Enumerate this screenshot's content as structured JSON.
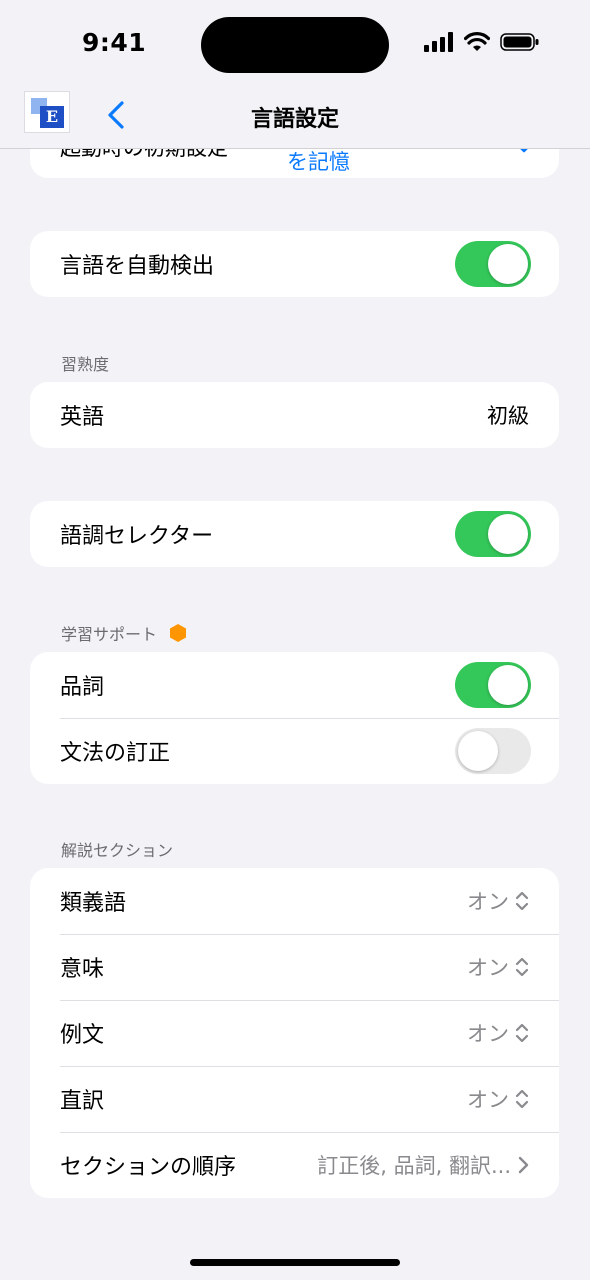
{
  "status": {
    "time": "9:41"
  },
  "nav": {
    "title": "言語設定",
    "logo_letter": "E"
  },
  "startup": {
    "label": "起動時の初期設定",
    "value": "を記憶"
  },
  "auto_detect": {
    "label": "言語を自動検出",
    "on": true
  },
  "proficiency": {
    "header": "習熟度",
    "row_label": "英語",
    "row_value": "初級"
  },
  "tone": {
    "label": "語調セレクター",
    "on": true
  },
  "learning": {
    "header": "学習サポート",
    "badge_color": "#ff9500",
    "items": [
      {
        "label": "品詞",
        "on": true
      },
      {
        "label": "文法の訂正",
        "on": false
      }
    ]
  },
  "explanation": {
    "header": "解説セクション",
    "items": [
      {
        "label": "類義語",
        "value": "オン"
      },
      {
        "label": "意味",
        "value": "オン"
      },
      {
        "label": "例文",
        "value": "オン"
      },
      {
        "label": "直訳",
        "value": "オン"
      }
    ],
    "order": {
      "label": "セクションの順序",
      "value": "訂正後, 品詞, 翻訳..."
    }
  },
  "colors": {
    "accent": "#0a7aff",
    "toggle_on": "#34c759",
    "background": "#f2f2f7"
  }
}
